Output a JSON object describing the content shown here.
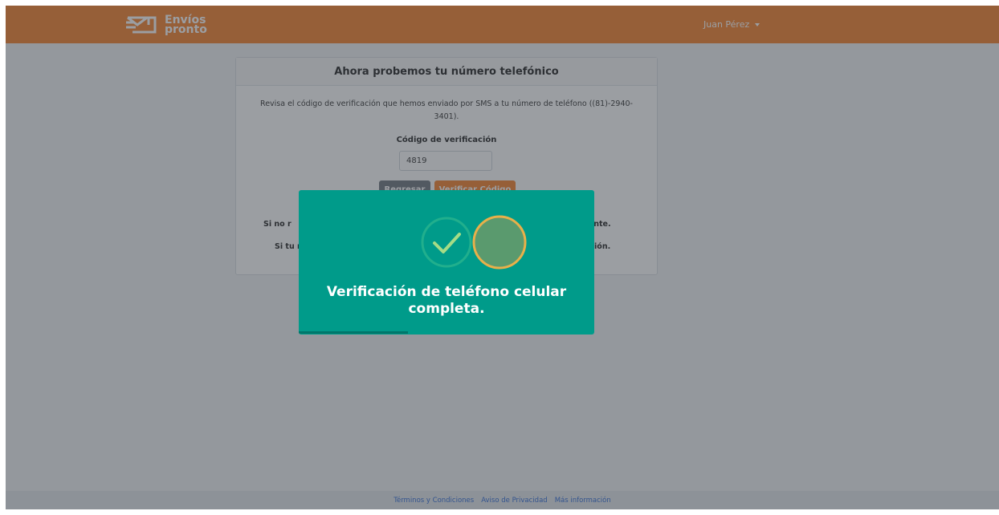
{
  "header": {
    "brand": {
      "line1": "Envíos",
      "line2": "pronto"
    },
    "user_name": "Juan Pérez"
  },
  "card": {
    "title": "Ahora probemos tu número telefónico",
    "description": "Revisa el código de verificación que hemos enviado por SMS a tu número de teléfono ((81)-2940-3401).",
    "code_label": "Código de verificación",
    "code_value": "4819",
    "back_button": "Regresar",
    "verify_button": "Verificar Código",
    "note1_visible_left": "Si no r",
    "note1_visible_right": "nente.",
    "note2_visible_left": "Si tu n",
    "note2_visible_right": "ación."
  },
  "toast": {
    "message": "Verificación de teléfono celular completa.",
    "progress": 0.37
  },
  "footer": {
    "links": [
      "Términos y Condiciones",
      "Aviso de Privacidad",
      "Más información"
    ]
  },
  "colors": {
    "brand_orange": "#f5802a",
    "toast_teal": "#009b8a",
    "check_green": "#a5dc86",
    "circle_gold": "#e8b04a"
  }
}
